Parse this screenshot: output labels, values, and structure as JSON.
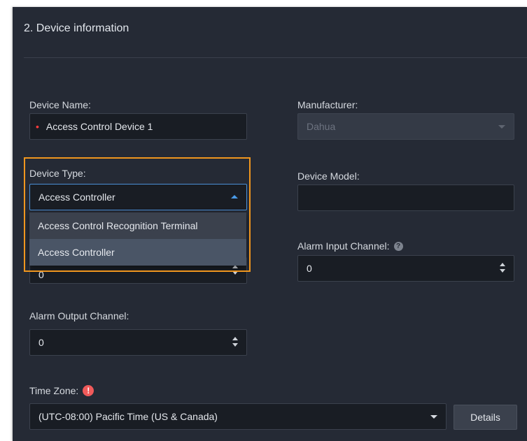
{
  "section": {
    "title": "2. Device information"
  },
  "device_name": {
    "label": "Device Name:",
    "value": "Access Control Device 1",
    "required_mark": "•"
  },
  "manufacturer": {
    "label": "Manufacturer:",
    "value": "Dahua"
  },
  "device_type": {
    "label": "Device Type:",
    "value": "Access Controller",
    "options": [
      "Access Control Recognition Terminal",
      "Access Controller"
    ],
    "selected_index": 1
  },
  "device_model": {
    "label": "Device Model:",
    "value": ""
  },
  "hidden_channel": {
    "value": "0"
  },
  "alarm_input_channel": {
    "label": "Alarm Input Channel:",
    "value": "0",
    "help_glyph": "?"
  },
  "alarm_output_channel": {
    "label": "Alarm Output Channel:",
    "value": "0"
  },
  "time_zone": {
    "label": "Time Zone:",
    "value": "(UTC-08:00) Pacific Time (US & Canada)",
    "warn_glyph": "!"
  },
  "details_button": {
    "label": "Details"
  },
  "colors": {
    "panel": "#252a35",
    "input": "#191d24",
    "accent": "#4a8fd6",
    "highlight": "#f0961e",
    "warn": "#f05a5a"
  }
}
